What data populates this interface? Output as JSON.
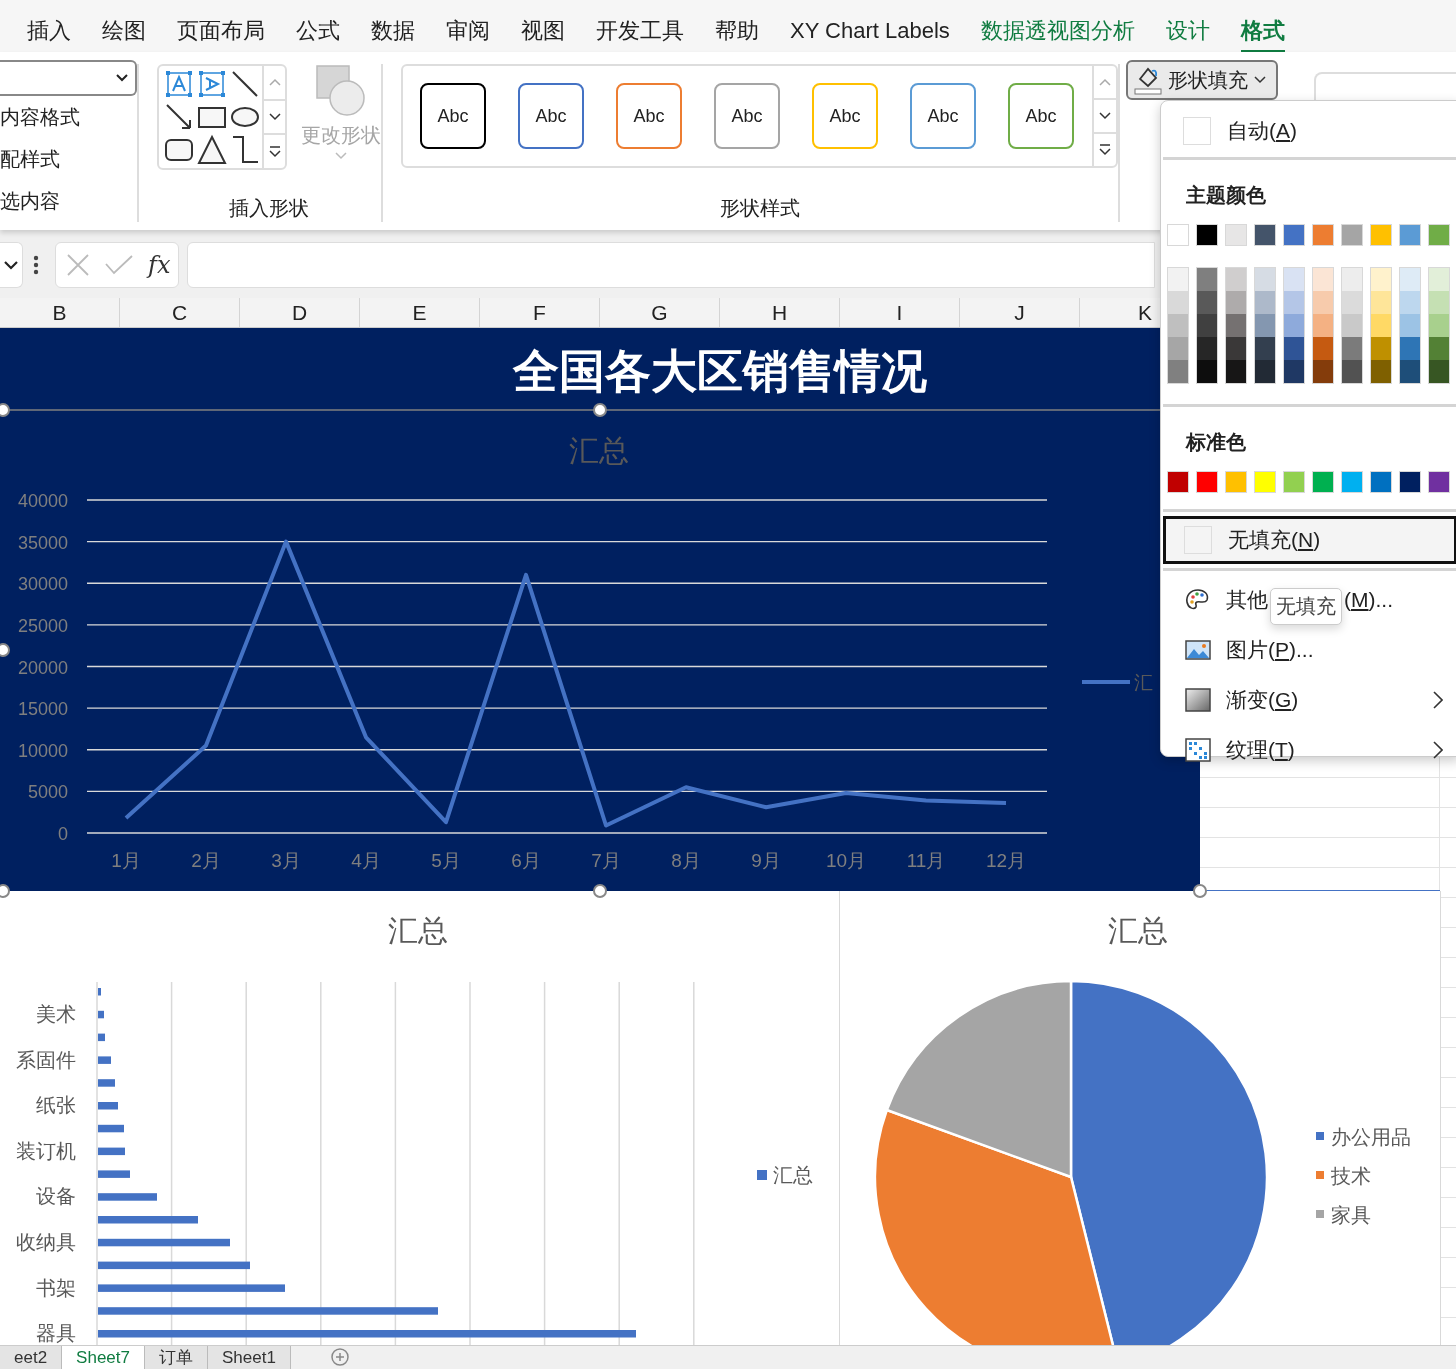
{
  "ribbon_tabs": [
    {
      "label": "插入",
      "selected": false,
      "contextual": false
    },
    {
      "label": "绘图",
      "selected": false,
      "contextual": false
    },
    {
      "label": "页面布局",
      "selected": false,
      "contextual": false
    },
    {
      "label": "公式",
      "selected": false,
      "contextual": false
    },
    {
      "label": "数据",
      "selected": false,
      "contextual": false
    },
    {
      "label": "审阅",
      "selected": false,
      "contextual": false
    },
    {
      "label": "视图",
      "selected": false,
      "contextual": false
    },
    {
      "label": "开发工具",
      "selected": false,
      "contextual": false
    },
    {
      "label": "帮助",
      "selected": false,
      "contextual": false
    },
    {
      "label": "XY Chart Labels",
      "selected": false,
      "contextual": false
    },
    {
      "label": "数据透视图分析",
      "selected": false,
      "contextual": true
    },
    {
      "label": "设计",
      "selected": false,
      "contextual": true
    },
    {
      "label": "格式",
      "selected": true,
      "contextual": true
    }
  ],
  "ribbon": {
    "left_group": {
      "items": [
        "内容格式",
        "配样式",
        "选内容"
      ]
    },
    "insert_shapes": {
      "label": "插入形状",
      "change_shape": {
        "label": "更改形状",
        "disabled": true
      }
    },
    "shape_styles": {
      "label": "形状样式",
      "presets": [
        {
          "label": "Abc",
          "color": "#000000"
        },
        {
          "label": "Abc",
          "color": "#4472c4"
        },
        {
          "label": "Abc",
          "color": "#ed7d31"
        },
        {
          "label": "Abc",
          "color": "#a5a5a5"
        },
        {
          "label": "Abc",
          "color": "#ffc000"
        },
        {
          "label": "Abc",
          "color": "#5b9bd5"
        },
        {
          "label": "Abc",
          "color": "#70ad47"
        }
      ]
    },
    "shape_fill_button": {
      "label": "形状填充"
    }
  },
  "formula_bar": {
    "function_label": "fx"
  },
  "columns": [
    "B",
    "C",
    "D",
    "E",
    "F",
    "G",
    "H",
    "I",
    "J",
    "K"
  ],
  "line_chart": {
    "title_box": "全国各大区销售情况",
    "chart_data": {
      "type": "line",
      "title": "汇总",
      "categories": [
        "1月",
        "2月",
        "3月",
        "4月",
        "5月",
        "6月",
        "7月",
        "8月",
        "9月",
        "10月",
        "11月",
        "12月"
      ],
      "series": [
        {
          "name": "汇",
          "color": "#4472c4",
          "values": [
            1800,
            10500,
            35000,
            11500,
            1300,
            31000,
            900,
            5500,
            3100,
            4800,
            3900,
            3600
          ]
        }
      ],
      "grid": true,
      "ylim": [
        0,
        40000
      ],
      "yticks": [
        0,
        5000,
        10000,
        15000,
        20000,
        25000,
        30000,
        35000,
        40000
      ]
    }
  },
  "bar_chart": {
    "title": "汇总",
    "category_labels": [
      "美术",
      "系固件",
      "纸张",
      "装订机",
      "设备",
      "收纳具",
      "书架",
      "器具"
    ],
    "legend": "汇总"
  },
  "pie_chart": {
    "title": "汇总",
    "legend": [
      {
        "label": "办公用品",
        "color": "#4472c4"
      },
      {
        "label": "技术",
        "color": "#ed7d31"
      },
      {
        "label": "家具",
        "color": "#a5a5a5"
      }
    ]
  },
  "sheet_tabs": [
    {
      "label": "eet2",
      "selected": false
    },
    {
      "label": "Sheet7",
      "selected": true
    },
    {
      "label": "订单",
      "selected": false
    },
    {
      "label": "Sheet1",
      "selected": false
    }
  ],
  "fill_menu": {
    "auto_label": "自动(A)",
    "theme_heading": "主题颜色",
    "theme_colors": [
      {
        "color": "#ffffff"
      },
      {
        "color": "#000000"
      },
      {
        "color": "#e7e6e6"
      },
      {
        "color": "#44546a"
      },
      {
        "color": "#4472c4"
      },
      {
        "color": "#ed7d31"
      },
      {
        "color": "#a5a5a5"
      },
      {
        "color": "#ffc000"
      },
      {
        "color": "#5b9bd5"
      },
      {
        "color": "#70ad47"
      }
    ],
    "theme_shades": [
      {
        "shades": [
          {
            "color": "#f2f2f2"
          },
          {
            "color": "#d9d9d9"
          },
          {
            "color": "#bfbfbf"
          },
          {
            "color": "#a6a6a6"
          },
          {
            "color": "#808080"
          }
        ]
      },
      {
        "shades": [
          {
            "color": "#7f7f7f"
          },
          {
            "color": "#595959"
          },
          {
            "color": "#404040"
          },
          {
            "color": "#262626"
          },
          {
            "color": "#0d0d0d"
          }
        ]
      },
      {
        "shades": [
          {
            "color": "#d0cece"
          },
          {
            "color": "#aeabab"
          },
          {
            "color": "#757171"
          },
          {
            "color": "#3a3838"
          },
          {
            "color": "#171616"
          }
        ]
      },
      {
        "shades": [
          {
            "color": "#d6dce4"
          },
          {
            "color": "#adb9ca"
          },
          {
            "color": "#8497b0"
          },
          {
            "color": "#333f4f"
          },
          {
            "color": "#222a35"
          }
        ]
      },
      {
        "shades": [
          {
            "color": "#d9e2f3"
          },
          {
            "color": "#b4c6e7"
          },
          {
            "color": "#8eaadb"
          },
          {
            "color": "#2f5496"
          },
          {
            "color": "#1f3864"
          }
        ]
      },
      {
        "shades": [
          {
            "color": "#fbe5d5"
          },
          {
            "color": "#f7cbac"
          },
          {
            "color": "#f4b183"
          },
          {
            "color": "#c55a11"
          },
          {
            "color": "#843c0b"
          }
        ]
      },
      {
        "shades": [
          {
            "color": "#ededed"
          },
          {
            "color": "#dbdbdb"
          },
          {
            "color": "#c9c9c9"
          },
          {
            "color": "#7b7b7b"
          },
          {
            "color": "#525252"
          }
        ]
      },
      {
        "shades": [
          {
            "color": "#fff2cc"
          },
          {
            "color": "#fee599"
          },
          {
            "color": "#ffd965"
          },
          {
            "color": "#bf9000"
          },
          {
            "color": "#7f6000"
          }
        ]
      },
      {
        "shades": [
          {
            "color": "#deebf6"
          },
          {
            "color": "#bdd7ee"
          },
          {
            "color": "#9cc3e5"
          },
          {
            "color": "#2e75b5"
          },
          {
            "color": "#1e4e79"
          }
        ]
      },
      {
        "shades": [
          {
            "color": "#e2efd9"
          },
          {
            "color": "#c5e0b3"
          },
          {
            "color": "#a8d08d"
          },
          {
            "color": "#538135"
          },
          {
            "color": "#375623"
          }
        ]
      }
    ],
    "standard_heading": "标准色",
    "standard_colors": [
      {
        "color": "#c00000"
      },
      {
        "color": "#ff0000"
      },
      {
        "color": "#ffc000"
      },
      {
        "color": "#ffff00"
      },
      {
        "color": "#92d050"
      },
      {
        "color": "#00b050"
      },
      {
        "color": "#00b0f0"
      },
      {
        "color": "#0070c0"
      },
      {
        "color": "#002060"
      },
      {
        "color": "#7030a0"
      }
    ],
    "no_fill": {
      "label": "无填充(N)",
      "highlighted": true
    },
    "items": [
      {
        "kind": "palette",
        "label_parts": [
          "其他",
          "(M)..."
        ],
        "tooltip": "无填充",
        "submenu": false
      },
      {
        "kind": "picture",
        "label": "图片(P)...",
        "submenu": false
      },
      {
        "kind": "gradient",
        "label": "渐变(G)",
        "submenu": true
      },
      {
        "kind": "texture",
        "label": "纹理(T)",
        "submenu": true
      }
    ]
  }
}
